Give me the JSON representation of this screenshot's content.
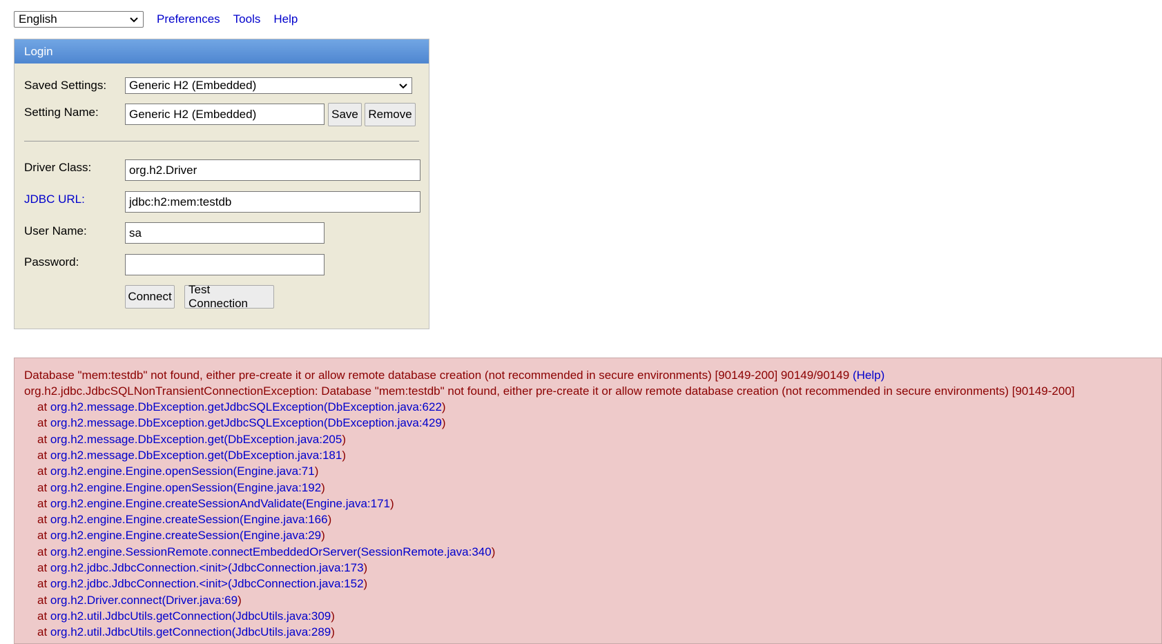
{
  "top": {
    "language": "English",
    "links": [
      "Preferences",
      "Tools",
      "Help"
    ]
  },
  "login": {
    "title": "Login",
    "saved_settings_label": "Saved Settings:",
    "saved_settings_value": "Generic H2 (Embedded)",
    "setting_name_label": "Setting Name:",
    "setting_name_value": "Generic H2 (Embedded)",
    "save_label": "Save",
    "remove_label": "Remove",
    "driver_class_label": "Driver Class:",
    "driver_class_value": "org.h2.Driver",
    "jdbc_url_label": "JDBC URL:",
    "jdbc_url_value": "jdbc:h2:mem:testdb",
    "user_name_label": "User Name:",
    "user_name_value": "sa",
    "password_label": "Password:",
    "password_value": "",
    "connect_label": "Connect",
    "test_connection_label": "Test Connection"
  },
  "error": {
    "message": "Database \"mem:testdb\" not found, either pre-create it or allow remote database creation (not recommended in secure environments) [90149-200] 90149/90149",
    "help_link": "(Help)",
    "exception": "org.h2.jdbc.JdbcSQLNonTransientConnectionException: Database \"mem:testdb\" not found, either pre-create it or allow remote database creation (not recommended in secure environments) [90149-200]",
    "at_prefix": "at",
    "trace": [
      "org.h2.message.DbException.getJdbcSQLException(DbException.java:622)",
      "org.h2.message.DbException.getJdbcSQLException(DbException.java:429)",
      "org.h2.message.DbException.get(DbException.java:205)",
      "org.h2.message.DbException.get(DbException.java:181)",
      "org.h2.engine.Engine.openSession(Engine.java:71)",
      "org.h2.engine.Engine.openSession(Engine.java:192)",
      "org.h2.engine.Engine.createSessionAndValidate(Engine.java:171)",
      "org.h2.engine.Engine.createSession(Engine.java:166)",
      "org.h2.engine.Engine.createSession(Engine.java:29)",
      "org.h2.engine.SessionRemote.connectEmbeddedOrServer(SessionRemote.java:340)",
      "org.h2.jdbc.JdbcConnection.<init>(JdbcConnection.java:173)",
      "org.h2.jdbc.JdbcConnection.<init>(JdbcConnection.java:152)",
      "org.h2.Driver.connect(Driver.java:69)",
      "org.h2.util.JdbcUtils.getConnection(JdbcUtils.java:309)",
      "org.h2.util.JdbcUtils.getConnection(JdbcUtils.java:289)"
    ]
  },
  "colors": {
    "link": "#0000cc",
    "error_text": "#8b0000",
    "error_bg": "#eecaca",
    "panel_bg": "#ece9d8",
    "header_blue": "#5b92d8"
  }
}
